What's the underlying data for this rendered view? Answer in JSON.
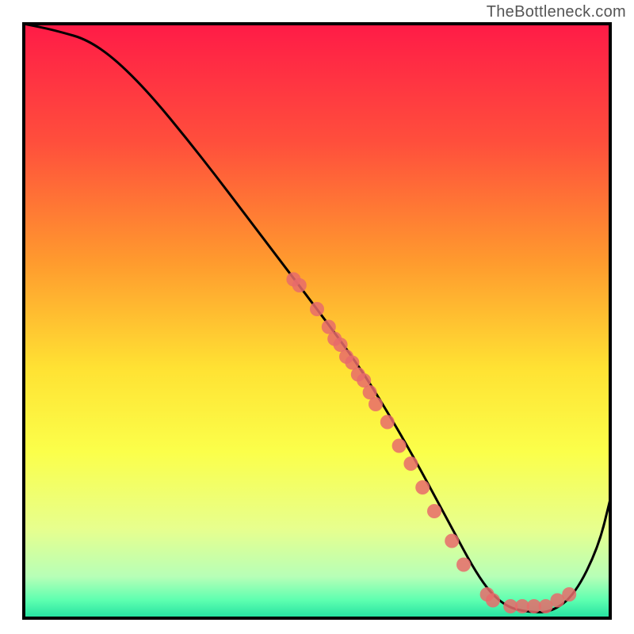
{
  "watermark": "TheBottleneck.com",
  "chart_data": {
    "type": "line",
    "title": "",
    "xlabel": "",
    "ylabel": "",
    "xlim": [
      0,
      100
    ],
    "ylim": [
      0,
      100
    ],
    "gradient_stops": [
      {
        "offset": 0.0,
        "color": "#ff1b47"
      },
      {
        "offset": 0.2,
        "color": "#ff4f3c"
      },
      {
        "offset": 0.4,
        "color": "#ff9a2e"
      },
      {
        "offset": 0.58,
        "color": "#ffe233"
      },
      {
        "offset": 0.72,
        "color": "#fbff4a"
      },
      {
        "offset": 0.85,
        "color": "#e7ff8e"
      },
      {
        "offset": 0.93,
        "color": "#b7ffb7"
      },
      {
        "offset": 0.97,
        "color": "#5dffb0"
      },
      {
        "offset": 1.0,
        "color": "#22e0a0"
      }
    ],
    "series": [
      {
        "name": "bottleneck-curve",
        "x": [
          0,
          5,
          12,
          20,
          30,
          40,
          50,
          56,
          60,
          66,
          72,
          78,
          82,
          86,
          90,
          94,
          98,
          100
        ],
        "values": [
          100,
          99,
          97,
          90,
          78,
          65,
          52,
          44,
          38,
          28,
          17,
          6,
          2,
          1,
          1,
          4,
          12,
          20
        ]
      }
    ],
    "markers": {
      "name": "highlighted-points",
      "color": "#e76b6b",
      "points": [
        {
          "x": 46,
          "y": 57
        },
        {
          "x": 47,
          "y": 56
        },
        {
          "x": 50,
          "y": 52
        },
        {
          "x": 52,
          "y": 49
        },
        {
          "x": 53,
          "y": 47
        },
        {
          "x": 54,
          "y": 46
        },
        {
          "x": 55,
          "y": 44
        },
        {
          "x": 56,
          "y": 43
        },
        {
          "x": 57,
          "y": 41
        },
        {
          "x": 58,
          "y": 40
        },
        {
          "x": 59,
          "y": 38
        },
        {
          "x": 60,
          "y": 36
        },
        {
          "x": 62,
          "y": 33
        },
        {
          "x": 64,
          "y": 29
        },
        {
          "x": 66,
          "y": 26
        },
        {
          "x": 68,
          "y": 22
        },
        {
          "x": 70,
          "y": 18
        },
        {
          "x": 73,
          "y": 13
        },
        {
          "x": 75,
          "y": 9
        },
        {
          "x": 79,
          "y": 4
        },
        {
          "x": 80,
          "y": 3
        },
        {
          "x": 83,
          "y": 2
        },
        {
          "x": 85,
          "y": 2
        },
        {
          "x": 87,
          "y": 2
        },
        {
          "x": 89,
          "y": 2
        },
        {
          "x": 91,
          "y": 3
        },
        {
          "x": 93,
          "y": 4
        }
      ]
    }
  }
}
